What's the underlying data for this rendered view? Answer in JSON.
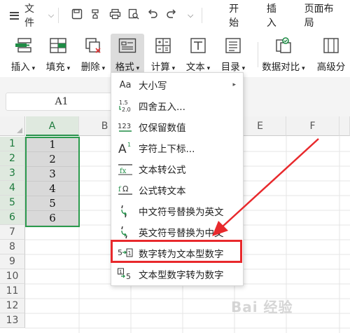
{
  "topbar": {
    "file_label": "文件",
    "tabs": [
      "开始",
      "插入",
      "页面布局"
    ]
  },
  "ribbon": {
    "buttons": [
      {
        "label": "插入",
        "icon": "insert-icon"
      },
      {
        "label": "填充",
        "icon": "fill-icon"
      },
      {
        "label": "删除",
        "icon": "delete-icon"
      },
      {
        "label": "格式",
        "icon": "format-icon",
        "active": true
      },
      {
        "label": "计算",
        "icon": "calculator-icon"
      },
      {
        "label": "文本",
        "icon": "text-icon"
      },
      {
        "label": "目录",
        "icon": "toc-icon"
      },
      {
        "label": "数据对比",
        "icon": "data-compare-icon"
      },
      {
        "label": "高级分",
        "icon": "advanced-split-icon"
      }
    ]
  },
  "formula_bar": {
    "cell_ref": "A1"
  },
  "sheet": {
    "columns": [
      "A",
      "B",
      "C",
      "D",
      "E",
      "F"
    ],
    "rows": [
      "1",
      "2",
      "3",
      "4",
      "5",
      "6",
      "7",
      "8",
      "9",
      "10",
      "11",
      "12",
      "13"
    ],
    "colA_values": [
      "1",
      "2",
      "3",
      "4",
      "5",
      "6"
    ]
  },
  "menu": {
    "items": [
      {
        "label": "大小写",
        "icon": "Aa",
        "submenu": true
      },
      {
        "label": "四舍五入...",
        "icon": "1.5→2.0"
      },
      {
        "label": "仅保留数值",
        "icon": "123"
      },
      {
        "label": "字符上下标...",
        "icon": "A1"
      },
      {
        "label": "文本转公式",
        "icon": "fx"
      },
      {
        "label": "公式转文本",
        "icon": "fΩ"
      },
      {
        "label": "中文符号替换为英文",
        "icon": "，→,"
      },
      {
        "label": "英文符号替换为中文",
        "icon": ",→，"
      },
      {
        "label": "数字转为文本型数字",
        "icon": "5→1",
        "highlighted": true
      },
      {
        "label": "文本型数字转为数字",
        "icon": "1→5"
      }
    ]
  },
  "colors": {
    "selection_green": "#2c9b4e",
    "highlight_red": "#e8292c",
    "active_button_bg": "#dcdcdc"
  }
}
